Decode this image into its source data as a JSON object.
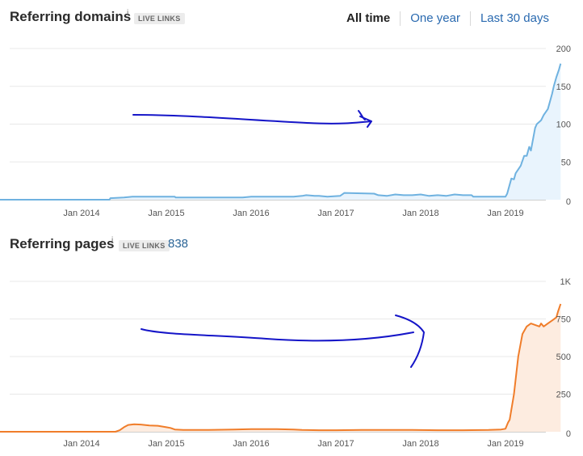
{
  "range_tabs": [
    {
      "label": "All time",
      "active": true
    },
    {
      "label": "One year",
      "active": false
    },
    {
      "label": "Last 30 days",
      "active": false
    }
  ],
  "chart_data": [
    {
      "type": "area",
      "title": "Referring domains",
      "info_icon": "i",
      "badge": "LIVE LINKS",
      "count": "",
      "color": "#6fb2e0",
      "fill": "#e9f4fd",
      "y_axis_position": "right",
      "ylim": [
        0,
        200
      ],
      "y_ticks": [
        50,
        100,
        150,
        200
      ],
      "y_tick_labels": [
        "50",
        "100",
        "150",
        "200"
      ],
      "zero_label": "0",
      "xlim": [
        2013.0,
        2019.7
      ],
      "x_ticks": [
        2014,
        2015,
        2016,
        2017,
        2018,
        2019
      ],
      "x_tick_labels": [
        "Jan 2014",
        "Jan 2015",
        "Jan 2016",
        "Jan 2017",
        "Jan 2018",
        "Jan 2019"
      ],
      "series": [
        {
          "x": [
            2013.0,
            2014.33,
            2014.34,
            2014.5,
            2014.6,
            2015.1,
            2015.11,
            2015.9,
            2016.0,
            2016.5,
            2016.6,
            2016.65,
            2016.75,
            2016.8,
            2016.9,
            2017.05,
            2017.1,
            2017.45,
            2017.5,
            2017.6,
            2017.7,
            2017.8,
            2017.9,
            2018.0,
            2018.1,
            2018.2,
            2018.3,
            2018.4,
            2018.5,
            2018.6,
            2018.62,
            2018.7,
            2018.85,
            2018.95,
            2019.0,
            2019.02,
            2019.05,
            2019.07,
            2019.1,
            2019.12,
            2019.18,
            2019.22,
            2019.25,
            2019.28,
            2019.3,
            2019.35,
            2019.37,
            2019.42,
            2019.45,
            2019.5,
            2019.52,
            2019.55,
            2019.57,
            2019.6,
            2019.63,
            2019.65
          ],
          "y": [
            0,
            0,
            2,
            3,
            4,
            4,
            3,
            3,
            4,
            4,
            5,
            6,
            5,
            5,
            4,
            5,
            9,
            8,
            6,
            5,
            7,
            6,
            6,
            7,
            5,
            6,
            5,
            7,
            6,
            6,
            4,
            4,
            4,
            4,
            4,
            8,
            20,
            28,
            27,
            35,
            45,
            58,
            58,
            70,
            65,
            95,
            100,
            105,
            112,
            120,
            128,
            140,
            150,
            162,
            172,
            180
          ]
        }
      ]
    },
    {
      "type": "area",
      "title": "Referring pages",
      "info_icon": "i",
      "badge": "LIVE LINKS",
      "count": "838",
      "color": "#f07d2a",
      "fill": "#fdece0",
      "y_axis_position": "right",
      "ylim": [
        0,
        1000
      ],
      "y_ticks": [
        250,
        500,
        750,
        1000
      ],
      "y_tick_labels": [
        "250",
        "500",
        "750",
        "1K"
      ],
      "zero_label": "0",
      "xlim": [
        2013.0,
        2019.7
      ],
      "x_ticks": [
        2014,
        2015,
        2016,
        2017,
        2018,
        2019
      ],
      "x_tick_labels": [
        "Jan 2014",
        "Jan 2015",
        "Jan 2016",
        "Jan 2017",
        "Jan 2018",
        "Jan 2019"
      ],
      "series": [
        {
          "x": [
            2013.0,
            2014.4,
            2014.45,
            2014.5,
            2014.55,
            2014.62,
            2014.7,
            2014.8,
            2014.9,
            2015.0,
            2015.05,
            2015.1,
            2015.2,
            2015.5,
            2015.8,
            2016.0,
            2016.3,
            2016.5,
            2016.6,
            2016.8,
            2017.0,
            2017.3,
            2017.6,
            2017.9,
            2018.2,
            2018.5,
            2018.8,
            2018.95,
            2019.0,
            2019.03,
            2019.05,
            2019.1,
            2019.15,
            2019.2,
            2019.25,
            2019.3,
            2019.35,
            2019.4,
            2019.42,
            2019.45,
            2019.5,
            2019.55,
            2019.6,
            2019.62,
            2019.65
          ],
          "y": [
            0,
            0,
            10,
            30,
            45,
            50,
            48,
            42,
            40,
            30,
            25,
            15,
            12,
            12,
            15,
            18,
            18,
            15,
            12,
            10,
            10,
            12,
            12,
            12,
            10,
            10,
            12,
            15,
            20,
            60,
            80,
            250,
            500,
            650,
            700,
            720,
            710,
            700,
            720,
            700,
            720,
            740,
            760,
            800,
            850
          ]
        }
      ]
    }
  ]
}
